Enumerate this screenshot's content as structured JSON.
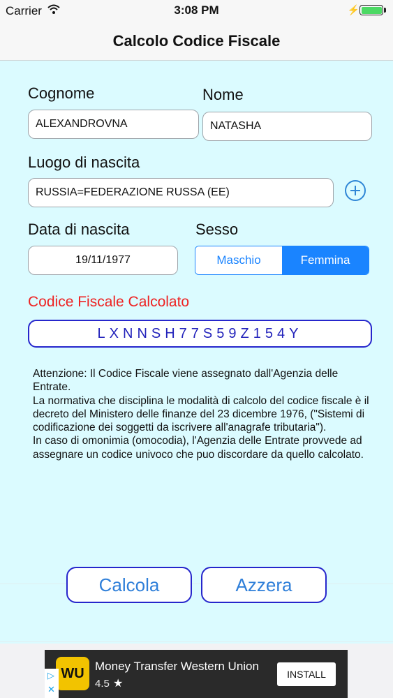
{
  "status": {
    "carrier": "Carrier",
    "time": "3:08 PM"
  },
  "nav": {
    "title": "Calcolo Codice Fiscale"
  },
  "form": {
    "surname_label": "Cognome",
    "surname_value": "ALEXANDROVNA",
    "name_label": "Nome",
    "name_value": "NATASHA",
    "birthplace_label": "Luogo di nascita",
    "birthplace_value": "RUSSIA=FEDERAZIONE RUSSA (EE)",
    "birthdate_label": "Data di nascita",
    "birthdate_value": "19/11/1977",
    "sex_label": "Sesso",
    "sex_options": [
      "Maschio",
      "Femmina"
    ],
    "sex_selected": "Femmina"
  },
  "result": {
    "label": "Codice Fiscale Calcolato",
    "code": "LXNNSH77S59Z154Y"
  },
  "notice": {
    "line1": "Attenzione: Il Codice Fiscale viene assegnato dall'Agenzia delle Entrate.",
    "line2": "La normativa che disciplina le modalità di calcolo del codice fiscale è il decreto del Ministero delle finanze del 23 dicembre 1976, (\"Sistemi di codificazione dei soggetti da iscrivere all'anagrafe tributaria\").",
    "line3": "In caso di omonimia (omocodia), l'Agenzia delle Entrate provvede ad assegnare un codice univoco che puo discordare da quello calcolato."
  },
  "actions": {
    "calculate": "Calcola",
    "reset": "Azzera"
  },
  "ad": {
    "logo_text": "WU",
    "title": "Money Transfer Western Union",
    "rating": "4.5",
    "install": "INSTALL"
  },
  "colors": {
    "accent": "#1a84ff",
    "result_border": "#2626cc",
    "error_label": "#ee2222",
    "background": "#dbfbff"
  }
}
